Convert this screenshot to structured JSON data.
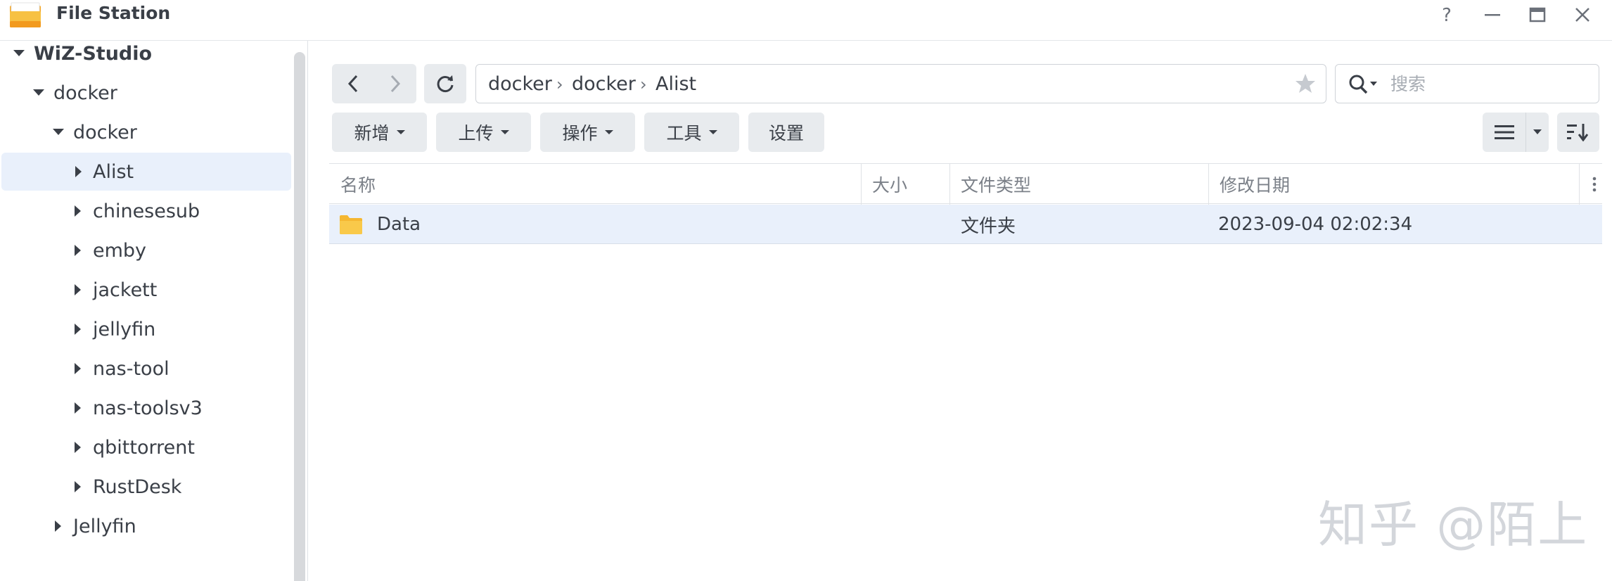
{
  "window": {
    "title": "File Station",
    "controls": [
      "help-icon",
      "minimize-icon",
      "maximize-icon",
      "close-icon"
    ]
  },
  "sidebar": {
    "root": "WiZ-Studio",
    "items": [
      {
        "label": "WiZ-Studio",
        "depth": 0,
        "state": "expanded"
      },
      {
        "label": "docker",
        "depth": 1,
        "state": "expanded"
      },
      {
        "label": "docker",
        "depth": 2,
        "state": "expanded"
      },
      {
        "label": "Alist",
        "depth": 3,
        "state": "collapsed",
        "selected": true
      },
      {
        "label": "chinesesub",
        "depth": 3,
        "state": "collapsed"
      },
      {
        "label": "emby",
        "depth": 3,
        "state": "collapsed"
      },
      {
        "label": "jackett",
        "depth": 3,
        "state": "collapsed"
      },
      {
        "label": "jellyfin",
        "depth": 3,
        "state": "collapsed"
      },
      {
        "label": "nas-tool",
        "depth": 3,
        "state": "collapsed"
      },
      {
        "label": "nas-toolsv3",
        "depth": 3,
        "state": "collapsed"
      },
      {
        "label": "qbittorrent",
        "depth": 3,
        "state": "collapsed"
      },
      {
        "label": "RustDesk",
        "depth": 3,
        "state": "collapsed"
      },
      {
        "label": "Jellyfin",
        "depth": 2,
        "state": "collapsed"
      }
    ]
  },
  "toolbar": {
    "breadcrumb": [
      "docker",
      "docker",
      "Alist"
    ],
    "search_placeholder": "搜索",
    "buttons": {
      "create": "新增",
      "upload": "上传",
      "action": "操作",
      "tools": "工具",
      "settings": "设置"
    }
  },
  "table": {
    "columns": [
      "名称",
      "大小",
      "文件类型",
      "修改日期"
    ],
    "rows": [
      {
        "name": "Data",
        "size": "",
        "type": "文件夹",
        "modified": "2023-09-04 02:02:34"
      }
    ]
  },
  "watermark": "知乎 @陌上",
  "colors": {
    "selection": "#e9f0fb",
    "button": "#e8ebee",
    "folder": "#f7c143",
    "text": "#3a3f47"
  }
}
